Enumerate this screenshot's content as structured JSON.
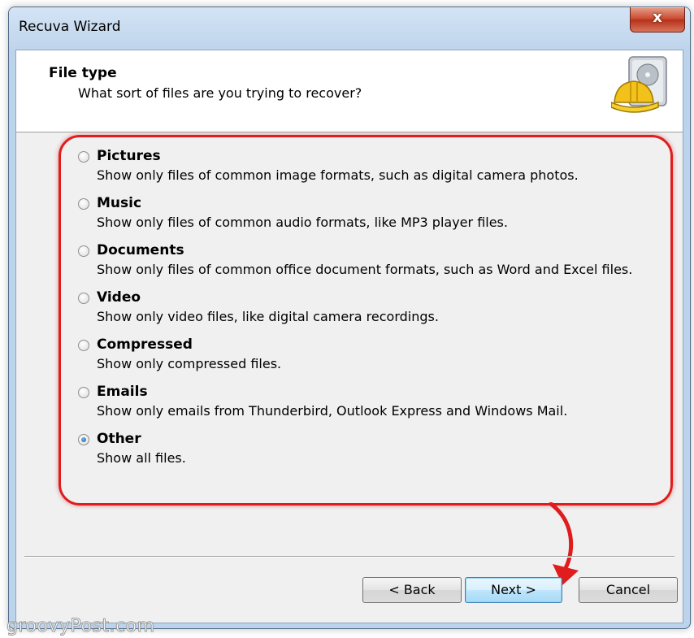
{
  "window": {
    "title": "Recuva Wizard",
    "close_label": "x"
  },
  "header": {
    "title": "File type",
    "subtitle": "What sort of files are you trying to recover?"
  },
  "options": [
    {
      "label": "Pictures",
      "description": "Show only files of common image formats, such as digital camera photos.",
      "selected": false
    },
    {
      "label": "Music",
      "description": "Show only files of common audio formats, like MP3 player files.",
      "selected": false
    },
    {
      "label": "Documents",
      "description": "Show only files of common office document formats, such as Word and Excel files.",
      "selected": false
    },
    {
      "label": "Video",
      "description": "Show only video files, like digital camera recordings.",
      "selected": false
    },
    {
      "label": "Compressed",
      "description": "Show only compressed files.",
      "selected": false
    },
    {
      "label": "Emails",
      "description": "Show only emails from Thunderbird, Outlook Express and Windows Mail.",
      "selected": false
    },
    {
      "label": "Other",
      "description": "Show all files.",
      "selected": true
    }
  ],
  "buttons": {
    "back": "< Back",
    "next": "Next >",
    "cancel": "Cancel"
  },
  "annotation": {
    "highlight_color": "#e01c1c"
  },
  "watermark": "groovyPost.com",
  "colors": {
    "titlebar": "#bfd4ec",
    "close_button": "#c9452b",
    "dialog_bg": "#f0f0f0",
    "default_button": "#bee6fd"
  },
  "icons": {
    "logo": "recuva-hardhat-disk-icon"
  }
}
